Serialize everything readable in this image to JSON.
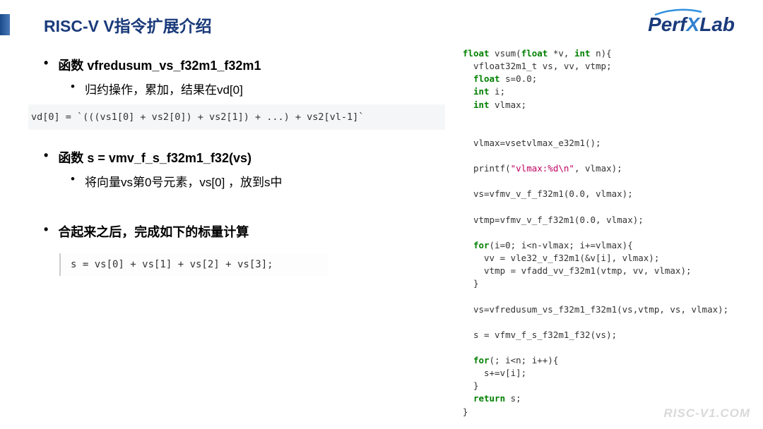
{
  "header": {
    "title": "RISC-V V指令扩展介绍",
    "logo_perf": "Perf",
    "logo_x": "X",
    "logo_lab": "Lab"
  },
  "left": {
    "b1_1": "函数 vfredusum_vs_f32m1_f32m1",
    "b1_1_sub": "归约操作，累加，结果在vd[0]",
    "code1": "vd[0] = `(((vs1[0] + vs2[0]) + vs2[1]) + ...) + vs2[vl-1]`",
    "b2_1": "函数 s = vmv_f_s_f32m1_f32(vs)",
    "b2_1_sub": "将向量vs第0号元素，vs[0] ，放到s中",
    "b3_1": "合起来之后，完成如下的标量计算",
    "code2": "s = vs[0] + vs[1] + vs[2] + vs[3];"
  },
  "right_code": {
    "l1a": "float",
    "l1b": " vsum(",
    "l1c": "float",
    "l1d": " *v, ",
    "l1e": "int",
    "l1f": " n){",
    "l2": "  vfloat32m1_t vs, vv, vtmp;",
    "l3a": "  ",
    "l3b": "float",
    "l3c": " s=",
    "l3d": "0.0",
    "l3e": ";",
    "l4a": "  ",
    "l4b": "int",
    "l4c": " i;",
    "l5a": "  ",
    "l5b": "int",
    "l5c": " vlmax;",
    "l6": " ",
    "l7": " ",
    "l8": "  vlmax=vsetvlmax_e32m1();",
    "l9": " ",
    "l10a": "  printf(",
    "l10b": "\"vlmax:%d\\n\"",
    "l10c": ", vlmax);",
    "l11": " ",
    "l12a": "  vs=vfmv_v_f_f32m1(",
    "l12b": "0.0",
    "l12c": ", vlmax);",
    "l13": " ",
    "l14a": "  vtmp=vfmv_v_f_f32m1(",
    "l14b": "0.0",
    "l14c": ", vlmax);",
    "l15": " ",
    "l16a": "  ",
    "l16b": "for",
    "l16c": "(i=",
    "l16d": "0",
    "l16e": "; i<n-vlmax; i+=vlmax){",
    "l17": "    vv = vle32_v_f32m1(&v[i], vlmax);",
    "l18": "    vtmp = vfadd_vv_f32m1(vtmp, vv, vlmax);",
    "l19": "  }",
    "l20": " ",
    "l21": "  vs=vfredusum_vs_f32m1_f32m1(vs,vtmp, vs, vlmax);",
    "l22": " ",
    "l23": "  s = vfmv_f_s_f32m1_f32(vs);",
    "l24": " ",
    "l25a": "  ",
    "l25b": "for",
    "l25c": "(; i<n; i++){",
    "l26": "    s+=v[i];",
    "l27": "  }",
    "l28a": "  ",
    "l28b": "return",
    "l28c": " s;",
    "l29": "}"
  },
  "watermark": "RISC-V1.COM"
}
